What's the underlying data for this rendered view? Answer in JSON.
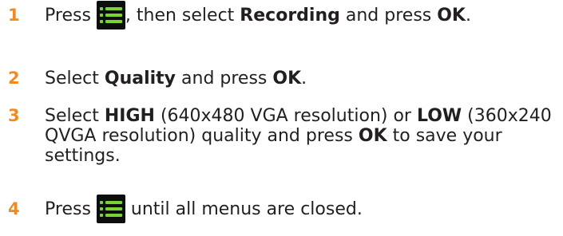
{
  "accent_color": "#f08a24",
  "icon_color": "#7ad234",
  "steps": [
    {
      "number": "1",
      "t1": "Press ",
      "icon": "menu-icon",
      "t2": ", then select ",
      "b1": "Recording",
      "t3": " and press ",
      "b2": "OK",
      "t4": "."
    },
    {
      "number": "2",
      "t1": "Select ",
      "b1": "Quality",
      "t2": " and press ",
      "b2": "OK",
      "t3": "."
    },
    {
      "number": "3",
      "t1": "Select ",
      "b1": "HIGH",
      "t2": " (640x480 VGA resolution) or ",
      "b2": "LOW",
      "t3": " (360x240 QVGA resolution) quality and press ",
      "b3": "OK",
      "t4": " to save your settings."
    },
    {
      "number": "4",
      "t1": "Press ",
      "icon": "menu-icon",
      "t2": " until all menus are closed."
    }
  ]
}
